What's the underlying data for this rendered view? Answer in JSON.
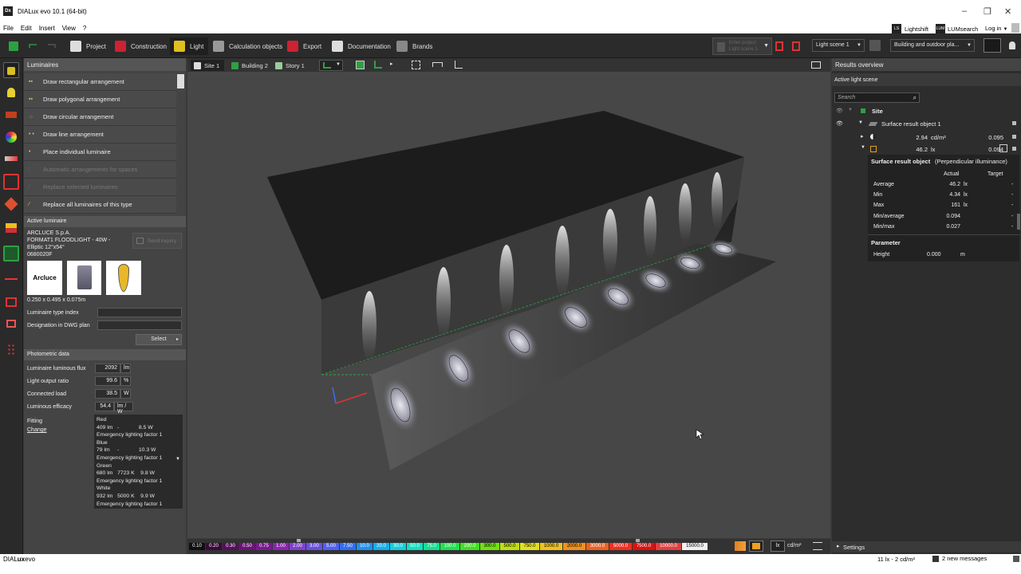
{
  "window": {
    "title": "DIALux evo 10.1  (64-bit)",
    "app_icon": "Dx"
  },
  "menu": [
    "File",
    "Edit",
    "Insert",
    "View",
    "?"
  ],
  "ribbon": {
    "tabs": [
      "Project",
      "Construction",
      "Light",
      "Calculation objects",
      "Export",
      "Documentation",
      "Brands"
    ],
    "active_tab": "Light",
    "lightshift": "Lightshift",
    "lumsearch": "LUMsearch",
    "login": "Log in",
    "light_scene": "Light scene 1",
    "building_select": "Building and outdoor pla...",
    "enter_project_1": "Enter project",
    "enter_project_2": "Light scene 1"
  },
  "luminaires_panel": {
    "title": "Luminaires",
    "tools": [
      {
        "label": "Draw rectangular arrangement",
        "enabled": true
      },
      {
        "label": "Draw polygonal arrangement",
        "enabled": true
      },
      {
        "label": "Draw circular arrangement",
        "enabled": true
      },
      {
        "label": "Draw line arrangement",
        "enabled": true
      },
      {
        "label": "Place individual luminaire",
        "enabled": true
      },
      {
        "label": "Automatic arrangements for spaces",
        "enabled": false
      },
      {
        "label": "Replace selected luminaires",
        "enabled": false
      },
      {
        "label": "Replace all luminaires of this type",
        "enabled": true
      }
    ],
    "active_luminaire_title": "Active luminaire",
    "manufacturer": "ARCLUCE S.p.A.",
    "name_line1": "FORMAT1 FLOODLIGHT - 40W -",
    "name_line2": "Elliptic 12°x54°",
    "code": "0680020F",
    "send_inquiry": "Send inquiry",
    "brand_logo": "Arcluce",
    "dimensions": "0.250 x 0.495 x 0.075m",
    "type_index_label": "Luminaire type index",
    "designation_label": "Designation in DWG plan",
    "select_button": "Select",
    "photometric_title": "Photometric data",
    "flux_label": "Luminaire luminous flux",
    "flux_value": "2092",
    "flux_unit": "lm",
    "lor_label": "Light output ratio",
    "lor_value": "99.6",
    "lor_unit": "%",
    "load_label": "Connected load",
    "load_value": "38.5",
    "load_unit": "W",
    "efficacy_label": "Luminous efficacy",
    "efficacy_value": "54.4",
    "efficacy_unit": "lm / W",
    "fitting_label": "Fitting",
    "change_link": "Change",
    "fitting_entries": [
      {
        "name": "Red",
        "line": "409 lm   -             8.5 W",
        "emergency": "Emergency lighting factor  1"
      },
      {
        "name": "Blue",
        "line": "79 lm     -             10.3 W",
        "emergency": "Emergency lighting factor  1"
      },
      {
        "name": "Green",
        "line": "680 lm   7723 K    9.8 W",
        "emergency": "Emergency lighting factor  1"
      },
      {
        "name": "White",
        "line": "932 lm   5000 K    9.9 W",
        "emergency": "Emergency lighting factor  1"
      }
    ]
  },
  "viewport": {
    "tabs": [
      "Site 1",
      "Building 2",
      "Story 1"
    ]
  },
  "legend": {
    "steps": [
      "0.10",
      "0.20",
      "0.30",
      "0.50",
      "0.75",
      "1.00",
      "2.00",
      "3.00",
      "5.00",
      "7.50",
      "10.0",
      "20.0",
      "30.0",
      "50.0",
      "75.0",
      "100.0",
      "200.0",
      "300.0",
      "500.0",
      "750.0",
      "1000.0",
      "2000.0",
      "3000.0",
      "5000.0",
      "7500.0",
      "10000.0",
      "15000.0"
    ],
    "colors": [
      "#101010",
      "#3a0a3a",
      "#55105a",
      "#6a1476",
      "#7a1a90",
      "#8a25b0",
      "#8040d0",
      "#6a50e0",
      "#5060f0",
      "#3070f0",
      "#2090f0",
      "#10b0f0",
      "#10d0e0",
      "#10e0c0",
      "#10e090",
      "#20e050",
      "#40e020",
      "#70e010",
      "#c0e010",
      "#e0e020",
      "#f0c020",
      "#f09020",
      "#f06020",
      "#f03020",
      "#e01010",
      "#e04040",
      "#f0f0f0"
    ],
    "unit_lx": "lx",
    "unit_cd": "cd/m²"
  },
  "results": {
    "title": "Results overview",
    "active_scene": "Active light scene",
    "search_placeholder": "Search",
    "site": "Site",
    "surface_object": "Surface result object 1",
    "row1_value": "2.94",
    "row1_unit": "cd/m²",
    "row1_ratio": "0.095",
    "row2_value": "46.2",
    "row2_unit": "lx",
    "row2_ratio": "0.094",
    "detail_title": "Surface result object",
    "detail_subtitle": "(Perpendicular illuminance)",
    "col_actual": "Actual",
    "col_target": "Target",
    "rows": [
      {
        "label": "Average",
        "value": "46.2",
        "unit": "lx",
        "target": "-"
      },
      {
        "label": "Min",
        "value": "4.34",
        "unit": "lx",
        "target": "-"
      },
      {
        "label": "Max",
        "value": "161",
        "unit": "lx",
        "target": "-"
      },
      {
        "label": "Min/average",
        "value": "0.094",
        "unit": "",
        "target": "-"
      },
      {
        "label": "Min/max",
        "value": "0.027",
        "unit": "",
        "target": "-"
      }
    ],
    "parameter_title": "Parameter",
    "height_label": "Height",
    "height_value": "0.000",
    "height_unit": "m",
    "settings": "Settings"
  },
  "status": {
    "brand_prefix": "DIAL",
    "brand_suffix": "ux",
    "brand_tail": "evo",
    "readout": "11 lx - 2 cd/m²",
    "messages": "2 new messages"
  }
}
